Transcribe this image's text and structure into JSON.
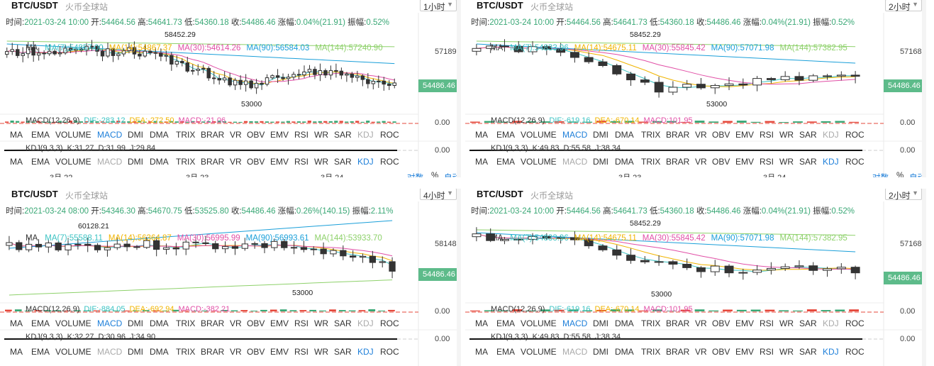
{
  "colors": {
    "up": "#ffffff",
    "down": "#333333",
    "ma7": "#3cc3c3",
    "ma14": "#f0b400",
    "ma30": "#e14fa6",
    "ma90": "#1a9fd9",
    "ma144": "#8ed16b",
    "pricebox": "#5dbb8a",
    "accent": "#1e7fd9"
  },
  "tabs": [
    "MA",
    "EMA",
    "VOLUME",
    "MACD",
    "DMI",
    "DMA",
    "TRIX",
    "BRAR",
    "VR",
    "OBV",
    "EMV",
    "RSI",
    "WR",
    "SAR",
    "KDJ",
    "ROC"
  ],
  "panels": [
    {
      "pair": "BTC/USDT",
      "exchange": "火币全球站",
      "interval": "1小时",
      "info": {
        "time_label": "时间:",
        "time": "2021-03-24 10:00",
        "open_label": "开:",
        "open": "54464.56",
        "high_label": "高:",
        "high": "54641.73",
        "low_label": "低:",
        "low": "54360.18",
        "close_label": "收:",
        "close": "54486.46",
        "change_label": "涨幅:",
        "change": "0.04%(21.91)",
        "amp_label": "振幅:",
        "amp": "0.52%"
      },
      "ma_label": "MA",
      "ma": [
        "MA(7):54857.00",
        "MA(14):54867.37",
        "MA(30):54614.26",
        "MA(90):56584.03",
        "MA(144):57240.90"
      ],
      "high_mark": "58452.29",
      "low_mark": "53000",
      "y_top": "57189.37",
      "price": "54486.46",
      "macd": {
        "label": "MACD(12,26,9)",
        "dif": "DIF:-283.12",
        "dea": "DEA:-272.50",
        "macd": "MACD:-21.06"
      },
      "macd_zero": "0.00",
      "kdj": {
        "label": "KDJ(9,3,3)",
        "k": "K:31.27",
        "d": "D:31.99",
        "j": "J:29.84"
      },
      "kdj_zero": "0.00",
      "dates": [
        "3月 22",
        "3月 23",
        "3月 24"
      ],
      "options": {
        "log": "对数",
        "pct": "%",
        "auto": "自动"
      },
      "active_tab_main": "MACD",
      "active_tab_sub": "KDJ"
    },
    {
      "pair": "BTC/USDT",
      "exchange": "火币全球站",
      "interval": "2小时",
      "info": {
        "time_label": "时间:",
        "time": "2021-03-24 10:00",
        "open_label": "开:",
        "open": "54464.56",
        "high_label": "高:",
        "high": "54641.73",
        "low_label": "低:",
        "low": "54360.18",
        "close_label": "收:",
        "close": "54486.46",
        "change_label": "涨幅:",
        "change": "0.04%(21.91)",
        "amp_label": "振幅:",
        "amp": "0.52%"
      },
      "ma_label": "MA",
      "ma": [
        "MA(7):54833.96",
        "MA(14):54675.11",
        "MA(30):55845.42",
        "MA(90):57071.98",
        "MA(144):57382.95"
      ],
      "high_mark": "58452.29",
      "low_mark": "53000",
      "y_top": "57168.47",
      "price": "54486.46",
      "macd": {
        "label": "MACD(12,26,9)",
        "dif": "DIF:-619.16",
        "dea": "DEA:-670.14",
        "macd": "MACD:101.95"
      },
      "macd_zero": "0.00",
      "kdj": {
        "label": "KDJ(9,3,3)",
        "k": "K:49.83",
        "d": "D:55.58",
        "j": "J:38.34"
      },
      "kdj_zero": "0.00",
      "dates": [
        "3月 23",
        "3月 24"
      ],
      "options": {
        "log": "对数",
        "pct": "%",
        "auto": "自动"
      },
      "active_tab_main": "MACD",
      "active_tab_sub": "KDJ"
    },
    {
      "pair": "BTC/USDT",
      "exchange": "火币全球站",
      "interval": "4小时",
      "info": {
        "time_label": "时间:",
        "time": "2021-03-24 08:00",
        "open_label": "开:",
        "open": "54346.30",
        "high_label": "高:",
        "high": "54670.75",
        "low_label": "低:",
        "low": "53525.80",
        "close_label": "收:",
        "close": "54486.46",
        "change_label": "涨幅:",
        "change": "0.26%(140.15)",
        "amp_label": "振幅:",
        "amp": "2.11%"
      },
      "ma_label": "MA",
      "ma": [
        "MA(7):55588.11",
        "MA(14):56364.87",
        "MA(30):56995.99",
        "MA(90):56993.61",
        "MA(144):53933.70"
      ],
      "high_mark": "60128.21",
      "low_mark": "53000",
      "y_top": "58148.92",
      "price": "54486.46",
      "macd": {
        "label": "MACD(12,26,9)",
        "dif": "DIF:-884.05",
        "dea": "DEA:-692.94",
        "macd": "MACD:-382.21"
      },
      "macd_zero": "0.00",
      "kdj": {
        "label": "KDJ(9,3,3)",
        "k": "K:32.27",
        "d": "D:30.96",
        "j": "J:34.90"
      },
      "kdj_zero": "0.00",
      "dates": [],
      "options": {},
      "active_tab_main": "MACD",
      "active_tab_sub": "KDJ"
    },
    {
      "pair": "BTC/USDT",
      "exchange": "火币全球站",
      "interval": "2小时",
      "info": {
        "time_label": "时间:",
        "time": "2021-03-24 10:00",
        "open_label": "开:",
        "open": "54464.56",
        "high_label": "高:",
        "high": "54641.73",
        "low_label": "低:",
        "low": "54360.18",
        "close_label": "收:",
        "close": "54486.46",
        "change_label": "涨幅:",
        "change": "0.04%(21.91)",
        "amp_label": "振幅:",
        "amp": "0.52%"
      },
      "ma_label": "MA",
      "ma": [
        "MA(7):54833.96",
        "MA(14):54675.11",
        "MA(30):55845.42",
        "MA(90):57071.98",
        "MA(144):57382.95"
      ],
      "high_mark": "58452.29",
      "low_mark": "53000",
      "y_top": "57168.47",
      "price": "54486.46",
      "macd": {
        "label": "MACD(12,26,9)",
        "dif": "DIF:-619.16",
        "dea": "DEA:-670.14",
        "macd": "MACD:101.95"
      },
      "macd_zero": "0.00",
      "kdj": {
        "label": "KDJ(9,3,3)",
        "k": "K:49.83",
        "d": "D:55.58",
        "j": "J:38.34"
      },
      "kdj_zero": "0.00",
      "dates": [],
      "options": {},
      "active_tab_main": "MACD",
      "active_tab_sub": "KDJ"
    }
  ]
}
